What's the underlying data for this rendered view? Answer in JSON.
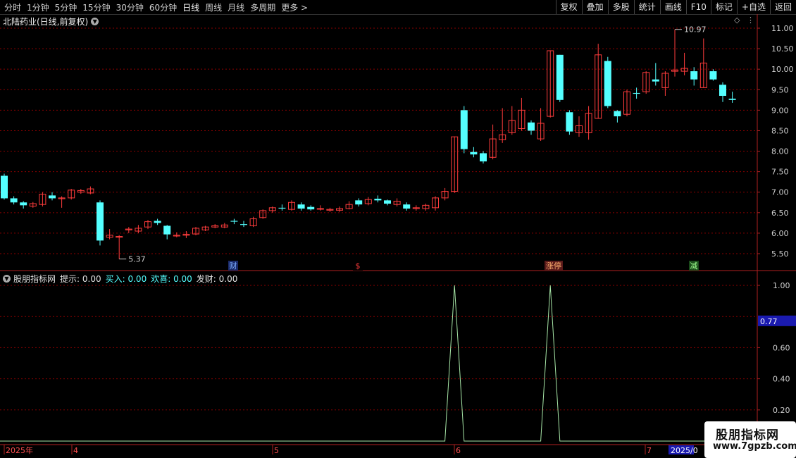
{
  "toolbar": {
    "periods": [
      "分时",
      "1分钟",
      "5分钟",
      "15分钟",
      "30分钟",
      "60分钟",
      "日线",
      "周线",
      "月线",
      "多周期",
      "更多 >"
    ],
    "active": "日线",
    "actions": [
      "复权",
      "叠加",
      "多股",
      "统计",
      "画线",
      "F10",
      "标记",
      "+自选",
      "返回"
    ]
  },
  "stock": {
    "title": "北陆药业(日线,前复权)"
  },
  "indicator": {
    "name": "股朋指标网",
    "hint_label": "提示:",
    "hint_value": "0.00",
    "buy_label": "买入:",
    "buy_value": "0.00",
    "joy_label": "欢喜:",
    "joy_value": "0.00",
    "fortune_label": "发财:",
    "fortune_value": "0.00"
  },
  "price_axis": {
    "ticks": [
      "11.00",
      "10.50",
      "10.00",
      "9.50",
      "9.00",
      "8.50",
      "8.00",
      "7.50",
      "7.00",
      "6.50",
      "6.00",
      "5.50"
    ]
  },
  "indicator_axis": {
    "ticks": [
      "1.00",
      "0.60",
      "0.40",
      "0.20"
    ],
    "current": "0.77"
  },
  "annotations": {
    "high": "10.97",
    "low": "5.37"
  },
  "event_markers": [
    "财",
    "$",
    "涨停",
    "减"
  ],
  "date_axis": {
    "labels": [
      "2025年",
      "4",
      "5",
      "6",
      "7",
      "2025/0"
    ]
  },
  "watermark": {
    "line1": "股朋指标网",
    "line2": "www.7gpzb.com"
  },
  "colors": {
    "up": "#ff3c3c",
    "down": "#54ffff",
    "grid": "#8b0000",
    "signal": "#a8e8a8"
  },
  "chart_data": {
    "type": "candlestick",
    "ylim": [
      5.3,
      11.1
    ],
    "candles": [
      [
        7.4,
        6.85,
        6.82,
        7.45
      ],
      [
        6.85,
        6.75,
        6.7,
        6.9
      ],
      [
        6.75,
        6.68,
        6.6,
        6.78
      ],
      [
        6.66,
        6.72,
        6.62,
        6.76
      ],
      [
        6.7,
        6.95,
        6.65,
        7.0
      ],
      [
        6.92,
        6.85,
        6.8,
        7.0
      ],
      [
        6.84,
        6.86,
        6.62,
        6.9
      ],
      [
        6.86,
        7.05,
        6.82,
        7.08
      ],
      [
        7.0,
        7.04,
        6.96,
        7.08
      ],
      [
        6.98,
        7.08,
        6.95,
        7.14
      ],
      [
        6.75,
        5.82,
        5.7,
        6.8
      ],
      [
        5.9,
        5.95,
        5.85,
        6.1
      ],
      [
        5.9,
        5.92,
        5.37,
        5.95
      ],
      [
        6.08,
        6.1,
        6.0,
        6.15
      ],
      [
        6.05,
        6.12,
        6.0,
        6.2
      ],
      [
        6.15,
        6.28,
        6.1,
        6.32
      ],
      [
        6.3,
        6.25,
        6.2,
        6.35
      ],
      [
        6.18,
        5.97,
        5.85,
        6.2
      ],
      [
        5.93,
        5.95,
        5.9,
        6.02
      ],
      [
        5.95,
        5.97,
        5.88,
        6.05
      ],
      [
        5.98,
        6.12,
        5.95,
        6.15
      ],
      [
        6.08,
        6.15,
        6.05,
        6.18
      ],
      [
        6.15,
        6.18,
        6.12,
        6.22
      ],
      [
        6.15,
        6.2,
        6.12,
        6.25
      ],
      [
        6.3,
        6.28,
        6.22,
        6.35
      ],
      [
        6.22,
        6.2,
        6.15,
        6.3
      ],
      [
        6.18,
        6.35,
        6.15,
        6.4
      ],
      [
        6.38,
        6.55,
        6.35,
        6.58
      ],
      [
        6.55,
        6.62,
        6.5,
        6.65
      ],
      [
        6.62,
        6.6,
        6.55,
        6.7
      ],
      [
        6.58,
        6.75,
        6.55,
        6.8
      ],
      [
        6.7,
        6.6,
        6.55,
        6.75
      ],
      [
        6.64,
        6.58,
        6.55,
        6.68
      ],
      [
        6.6,
        6.6,
        6.55,
        6.68
      ],
      [
        6.56,
        6.58,
        6.52,
        6.62
      ],
      [
        6.56,
        6.6,
        6.52,
        6.65
      ],
      [
        6.6,
        6.7,
        6.58,
        6.78
      ],
      [
        6.8,
        6.7,
        6.65,
        6.85
      ],
      [
        6.72,
        6.82,
        6.68,
        6.88
      ],
      [
        6.84,
        6.8,
        6.75,
        6.92
      ],
      [
        6.8,
        6.72,
        6.68,
        6.82
      ],
      [
        6.7,
        6.78,
        6.65,
        6.85
      ],
      [
        6.7,
        6.6,
        6.55,
        6.75
      ],
      [
        6.6,
        6.62,
        6.55,
        6.68
      ],
      [
        6.6,
        6.68,
        6.55,
        6.72
      ],
      [
        6.62,
        6.86,
        6.55,
        6.9
      ],
      [
        6.86,
        7.02,
        6.8,
        7.1
      ],
      [
        7.02,
        8.35,
        6.98,
        8.36
      ],
      [
        9.0,
        8.05,
        7.95,
        9.1
      ],
      [
        7.98,
        7.92,
        7.85,
        8.1
      ],
      [
        7.95,
        7.75,
        7.7,
        8.0
      ],
      [
        7.85,
        8.3,
        7.8,
        8.65
      ],
      [
        8.28,
        8.4,
        8.2,
        9.05
      ],
      [
        8.45,
        8.75,
        8.4,
        9.1
      ],
      [
        8.55,
        9.0,
        8.5,
        9.3
      ],
      [
        8.7,
        8.5,
        8.4,
        8.75
      ],
      [
        8.3,
        8.68,
        8.25,
        9.05
      ],
      [
        8.85,
        10.45,
        8.82,
        10.46
      ],
      [
        10.35,
        9.25,
        9.2,
        10.35
      ],
      [
        8.95,
        8.48,
        8.4,
        9.0
      ],
      [
        8.45,
        8.62,
        8.35,
        8.85
      ],
      [
        8.45,
        8.92,
        8.28,
        9.1
      ],
      [
        8.8,
        10.35,
        8.8,
        10.62
      ],
      [
        10.2,
        9.1,
        9.05,
        10.3
      ],
      [
        8.98,
        8.85,
        8.7,
        9.0
      ],
      [
        8.9,
        9.45,
        8.85,
        9.5
      ],
      [
        9.42,
        9.4,
        9.28,
        9.55
      ],
      [
        9.45,
        9.92,
        9.4,
        9.95
      ],
      [
        9.75,
        9.7,
        9.6,
        10.15
      ],
      [
        9.55,
        9.9,
        9.35,
        9.95
      ],
      [
        9.95,
        9.98,
        9.82,
        10.97
      ],
      [
        9.95,
        10.02,
        9.85,
        10.4
      ],
      [
        9.95,
        9.75,
        9.6,
        10.05
      ],
      [
        9.55,
        10.15,
        9.55,
        10.75
      ],
      [
        9.95,
        9.75,
        9.72,
        10.0
      ],
      [
        9.62,
        9.35,
        9.2,
        9.68
      ],
      [
        9.28,
        9.25,
        9.18,
        9.45
      ]
    ],
    "indicator": {
      "type": "line",
      "ylim": [
        0,
        1.05
      ],
      "signal_indices": [
        47,
        57
      ],
      "peak": 1.0
    }
  }
}
